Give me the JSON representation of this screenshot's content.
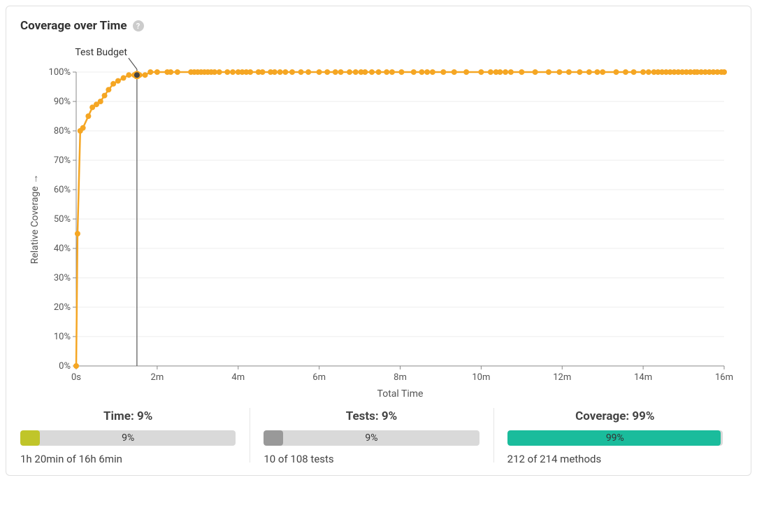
{
  "card": {
    "title": "Coverage over Time",
    "help_icon": "?"
  },
  "chart_data": {
    "type": "line",
    "title": "",
    "xlabel": "Total Time",
    "ylabel": "Relative Coverage  →",
    "x_unit": "seconds",
    "xlim": [
      0,
      960
    ],
    "ylim": [
      0,
      100
    ],
    "y_ticks": [
      0,
      10,
      20,
      30,
      40,
      50,
      60,
      70,
      80,
      90,
      100
    ],
    "y_tick_labels": [
      "0%",
      "10%",
      "20%",
      "30%",
      "40%",
      "50%",
      "60%",
      "70%",
      "80%",
      "90%",
      "100%"
    ],
    "x_ticks": [
      0,
      120,
      240,
      360,
      480,
      600,
      720,
      840,
      960
    ],
    "x_tick_labels": [
      "0s",
      "2m",
      "4m",
      "6m",
      "8m",
      "10m",
      "12m",
      "14m",
      "16m"
    ],
    "annotation": {
      "label": "Test Budget",
      "x": 90
    },
    "series": [
      {
        "name": "coverage",
        "points": [
          {
            "x": 0,
            "y": 0
          },
          {
            "x": 2,
            "y": 45
          },
          {
            "x": 6,
            "y": 80
          },
          {
            "x": 10,
            "y": 81
          },
          {
            "x": 18,
            "y": 85
          },
          {
            "x": 24,
            "y": 88
          },
          {
            "x": 30,
            "y": 89
          },
          {
            "x": 36,
            "y": 90
          },
          {
            "x": 42,
            "y": 92
          },
          {
            "x": 48,
            "y": 94
          },
          {
            "x": 55,
            "y": 96
          },
          {
            "x": 62,
            "y": 97
          },
          {
            "x": 70,
            "y": 98
          },
          {
            "x": 78,
            "y": 99
          },
          {
            "x": 86,
            "y": 99
          },
          {
            "x": 94,
            "y": 99
          },
          {
            "x": 102,
            "y": 99
          },
          {
            "x": 110,
            "y": 100
          },
          {
            "x": 120,
            "y": 100
          },
          {
            "x": 135,
            "y": 100
          },
          {
            "x": 140,
            "y": 100
          },
          {
            "x": 150,
            "y": 100
          },
          {
            "x": 170,
            "y": 100
          },
          {
            "x": 175,
            "y": 100
          },
          {
            "x": 180,
            "y": 100
          },
          {
            "x": 185,
            "y": 100
          },
          {
            "x": 190,
            "y": 100
          },
          {
            "x": 195,
            "y": 100
          },
          {
            "x": 200,
            "y": 100
          },
          {
            "x": 205,
            "y": 100
          },
          {
            "x": 212,
            "y": 100
          },
          {
            "x": 224,
            "y": 100
          },
          {
            "x": 232,
            "y": 100
          },
          {
            "x": 240,
            "y": 100
          },
          {
            "x": 246,
            "y": 100
          },
          {
            "x": 252,
            "y": 100
          },
          {
            "x": 258,
            "y": 100
          },
          {
            "x": 270,
            "y": 100
          },
          {
            "x": 276,
            "y": 100
          },
          {
            "x": 288,
            "y": 100
          },
          {
            "x": 294,
            "y": 100
          },
          {
            "x": 302,
            "y": 100
          },
          {
            "x": 310,
            "y": 100
          },
          {
            "x": 320,
            "y": 100
          },
          {
            "x": 333,
            "y": 100
          },
          {
            "x": 344,
            "y": 100
          },
          {
            "x": 360,
            "y": 100
          },
          {
            "x": 372,
            "y": 100
          },
          {
            "x": 384,
            "y": 100
          },
          {
            "x": 392,
            "y": 100
          },
          {
            "x": 405,
            "y": 100
          },
          {
            "x": 414,
            "y": 100
          },
          {
            "x": 422,
            "y": 100
          },
          {
            "x": 428,
            "y": 100
          },
          {
            "x": 438,
            "y": 100
          },
          {
            "x": 448,
            "y": 100
          },
          {
            "x": 460,
            "y": 100
          },
          {
            "x": 468,
            "y": 100
          },
          {
            "x": 482,
            "y": 100
          },
          {
            "x": 500,
            "y": 100
          },
          {
            "x": 512,
            "y": 100
          },
          {
            "x": 520,
            "y": 100
          },
          {
            "x": 528,
            "y": 100
          },
          {
            "x": 544,
            "y": 100
          },
          {
            "x": 560,
            "y": 100
          },
          {
            "x": 578,
            "y": 100
          },
          {
            "x": 600,
            "y": 100
          },
          {
            "x": 614,
            "y": 100
          },
          {
            "x": 622,
            "y": 100
          },
          {
            "x": 628,
            "y": 100
          },
          {
            "x": 636,
            "y": 100
          },
          {
            "x": 644,
            "y": 100
          },
          {
            "x": 660,
            "y": 100
          },
          {
            "x": 680,
            "y": 100
          },
          {
            "x": 700,
            "y": 100
          },
          {
            "x": 716,
            "y": 100
          },
          {
            "x": 730,
            "y": 100
          },
          {
            "x": 746,
            "y": 100
          },
          {
            "x": 760,
            "y": 100
          },
          {
            "x": 772,
            "y": 100
          },
          {
            "x": 780,
            "y": 100
          },
          {
            "x": 800,
            "y": 100
          },
          {
            "x": 814,
            "y": 100
          },
          {
            "x": 826,
            "y": 100
          },
          {
            "x": 840,
            "y": 100
          },
          {
            "x": 848,
            "y": 100
          },
          {
            "x": 856,
            "y": 100
          },
          {
            "x": 862,
            "y": 100
          },
          {
            "x": 868,
            "y": 100
          },
          {
            "x": 874,
            "y": 100
          },
          {
            "x": 880,
            "y": 100
          },
          {
            "x": 886,
            "y": 100
          },
          {
            "x": 892,
            "y": 100
          },
          {
            "x": 898,
            "y": 100
          },
          {
            "x": 904,
            "y": 100
          },
          {
            "x": 910,
            "y": 100
          },
          {
            "x": 916,
            "y": 100
          },
          {
            "x": 920,
            "y": 100
          },
          {
            "x": 926,
            "y": 100
          },
          {
            "x": 932,
            "y": 100
          },
          {
            "x": 938,
            "y": 100
          },
          {
            "x": 944,
            "y": 100
          },
          {
            "x": 950,
            "y": 100
          },
          {
            "x": 956,
            "y": 100
          },
          {
            "x": 960,
            "y": 100
          }
        ]
      }
    ]
  },
  "stats": {
    "time": {
      "title": "Time: 9%",
      "percent": 9,
      "bar_label": "9%",
      "subtitle": "1h 20min of 16h 6min",
      "color": "yellow"
    },
    "tests": {
      "title": "Tests: 9%",
      "percent": 9,
      "bar_label": "9%",
      "subtitle": "10 of 108 tests",
      "color": "grey"
    },
    "coverage": {
      "title": "Coverage: 99%",
      "percent": 99,
      "bar_label": "99%",
      "subtitle": "212 of 214 methods",
      "color": "teal"
    }
  }
}
